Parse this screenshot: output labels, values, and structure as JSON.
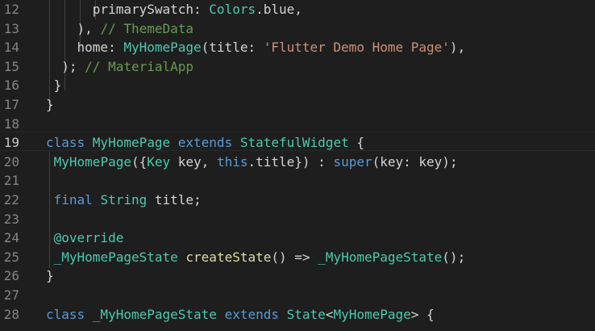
{
  "editor": {
    "active_line": "19",
    "lines": [
      {
        "number": "12",
        "tokens": [
          {
            "t": "      primarySwatch: ",
            "k": "plain"
          },
          {
            "t": "Colors",
            "k": "type"
          },
          {
            "t": ".blue,",
            "k": "plain"
          }
        ]
      },
      {
        "number": "13",
        "tokens": [
          {
            "t": "    ), ",
            "k": "plain"
          },
          {
            "t": "// ThemeData",
            "k": "cmt"
          }
        ]
      },
      {
        "number": "14",
        "tokens": [
          {
            "t": "    home: ",
            "k": "plain"
          },
          {
            "t": "MyHomePage",
            "k": "type"
          },
          {
            "t": "(title: ",
            "k": "plain"
          },
          {
            "t": "'Flutter Demo Home Page'",
            "k": "str"
          },
          {
            "t": "),",
            "k": "plain"
          }
        ]
      },
      {
        "number": "15",
        "tokens": [
          {
            "t": "  ); ",
            "k": "plain"
          },
          {
            "t": "// MaterialApp",
            "k": "cmt"
          }
        ]
      },
      {
        "number": "16",
        "tokens": [
          {
            "t": " }",
            "k": "plain"
          }
        ]
      },
      {
        "number": "17",
        "tokens": [
          {
            "t": "}",
            "k": "plain"
          }
        ]
      },
      {
        "number": "18",
        "tokens": []
      },
      {
        "number": "19",
        "tokens": [
          {
            "t": "class ",
            "k": "kw"
          },
          {
            "t": "MyHomePage",
            "k": "type"
          },
          {
            "t": " ",
            "k": "plain"
          },
          {
            "t": "extends",
            "k": "kw"
          },
          {
            "t": " ",
            "k": "plain"
          },
          {
            "t": "StatefulWidget",
            "k": "type"
          },
          {
            "t": " {",
            "k": "plain"
          }
        ]
      },
      {
        "number": "20",
        "tokens": [
          {
            "t": " ",
            "k": "plain"
          },
          {
            "t": "MyHomePage",
            "k": "type"
          },
          {
            "t": "({",
            "k": "plain"
          },
          {
            "t": "Key",
            "k": "type"
          },
          {
            "t": " key, ",
            "k": "plain"
          },
          {
            "t": "this",
            "k": "kw"
          },
          {
            "t": ".title}) : ",
            "k": "plain"
          },
          {
            "t": "super",
            "k": "kw"
          },
          {
            "t": "(key: key);",
            "k": "plain"
          }
        ]
      },
      {
        "number": "21",
        "tokens": []
      },
      {
        "number": "22",
        "tokens": [
          {
            "t": " ",
            "k": "plain"
          },
          {
            "t": "final",
            "k": "kw"
          },
          {
            "t": " ",
            "k": "plain"
          },
          {
            "t": "String",
            "k": "type"
          },
          {
            "t": " title;",
            "k": "plain"
          }
        ]
      },
      {
        "number": "23",
        "tokens": []
      },
      {
        "number": "24",
        "tokens": [
          {
            "t": " ",
            "k": "plain"
          },
          {
            "t": "@override",
            "k": "type"
          }
        ]
      },
      {
        "number": "25",
        "tokens": [
          {
            "t": " ",
            "k": "plain"
          },
          {
            "t": "_MyHomePageState",
            "k": "type"
          },
          {
            "t": " ",
            "k": "plain"
          },
          {
            "t": "createState",
            "k": "fn"
          },
          {
            "t": "() => ",
            "k": "plain"
          },
          {
            "t": "_MyHomePageState",
            "k": "type"
          },
          {
            "t": "();",
            "k": "plain"
          }
        ]
      },
      {
        "number": "26",
        "tokens": [
          {
            "t": "}",
            "k": "plain"
          }
        ]
      },
      {
        "number": "27",
        "tokens": []
      },
      {
        "number": "28",
        "tokens": [
          {
            "t": "class ",
            "k": "kw"
          },
          {
            "t": "_MyHomePageState",
            "k": "type"
          },
          {
            "t": " ",
            "k": "plain"
          },
          {
            "t": "extends",
            "k": "kw"
          },
          {
            "t": " ",
            "k": "plain"
          },
          {
            "t": "State",
            "k": "type"
          },
          {
            "t": "<",
            "k": "plain"
          },
          {
            "t": "MyHomePage",
            "k": "type"
          },
          {
            "t": "> {",
            "k": "plain"
          }
        ]
      }
    ]
  }
}
